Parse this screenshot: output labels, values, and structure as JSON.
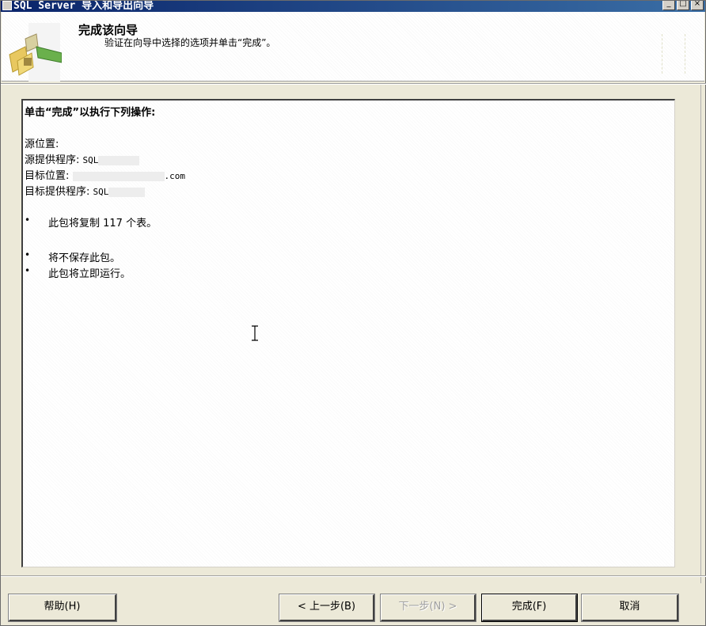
{
  "window": {
    "title": "SQL Server 导入和导出向导"
  },
  "header": {
    "title": "完成该向导",
    "subtitle": "验证在向导中选择的选项并单击“完成”。"
  },
  "summary": {
    "heading": "单击“完成”以执行下列操作:",
    "source_location_label": "源位置:",
    "source_provider_label": "源提供程序:",
    "source_provider_value": "SQL",
    "dest_location_label": "目标位置:",
    "dest_location_value": ".com",
    "dest_provider_label": "目标提供程序:",
    "dest_provider_value": "SQL",
    "bullet_symbol": "•",
    "bullets": [
      "此包将复制 117 个表。",
      "将不保存此包。",
      "此包将立即运行。"
    ]
  },
  "buttons": {
    "help": "帮助(H)",
    "back": "< 上一步(B)",
    "next": "下一步(N) >",
    "finish": "完成(F)",
    "cancel": "取消"
  }
}
